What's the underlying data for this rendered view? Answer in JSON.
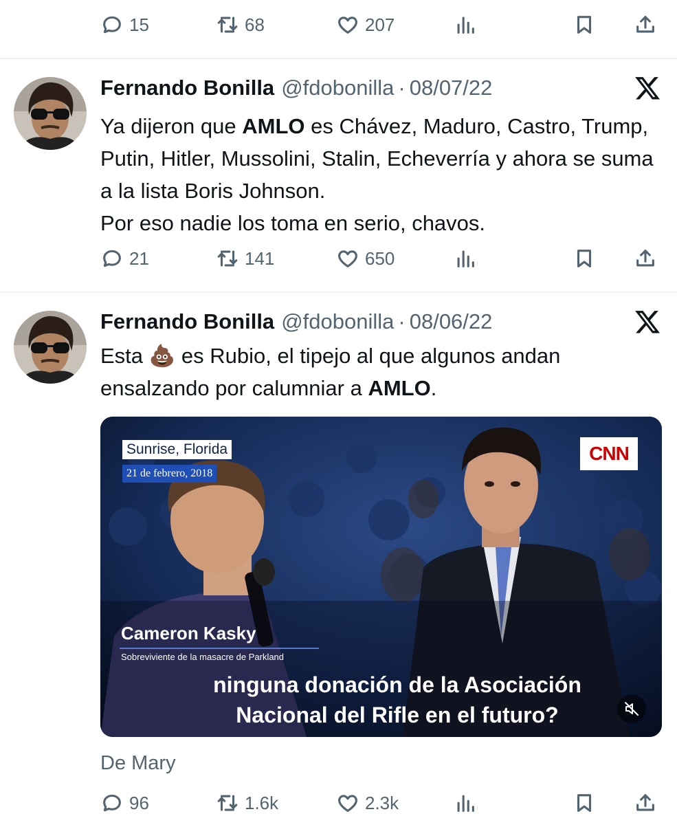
{
  "top_actions": {
    "replies": "15",
    "retweets": "68",
    "likes": "207"
  },
  "tweets": [
    {
      "author": "Fernando Bonilla",
      "handle": "@fdobonilla",
      "separator": "·",
      "date": "08/07/22",
      "text_before": "Ya dijeron que ",
      "bold_word": "AMLO",
      "text_after": " es Chávez,  Maduro, Castro, Trump, Putin, Hitler, Mussolini, Stalin, Echeverría y ahora se suma a la lista Boris Johnson.\nPor eso nadie los toma en serio, chavos.",
      "replies": "21",
      "retweets": "141",
      "likes": "650"
    },
    {
      "author": "Fernando Bonilla",
      "handle": "@fdobonilla",
      "separator": "·",
      "date": "08/06/22",
      "text_before": "Esta ",
      "emoji": "💩",
      "text_middle": " es Rubio, el tipejo al que algunos andan ensalzando por calumniar a ",
      "bold_word": "AMLO",
      "text_after": ".",
      "media": {
        "location": "Sunrise, Florida",
        "date": "21 de febrero, 2018",
        "network": "CNN",
        "speaker_name": "Cameron Kasky",
        "speaker_title": "Sobreviviente de la masacre de Parkland",
        "subtitle_line1": "ninguna donación de la Asociación",
        "subtitle_line2": "Nacional del Rifle en el futuro?"
      },
      "from_label": "De Mary",
      "replies": "96",
      "retweets": "1.6k",
      "likes": "2.3k"
    }
  ],
  "icons": {
    "reply": "reply-icon",
    "retweet": "retweet-icon",
    "like": "heart-icon",
    "views": "views-icon",
    "bookmark": "bookmark-icon",
    "share": "share-icon",
    "x": "x-logo-icon",
    "mute": "muted-speaker-icon"
  },
  "colors": {
    "text": "#0f1419",
    "secondary": "#536471",
    "divider": "#eff3f4"
  }
}
